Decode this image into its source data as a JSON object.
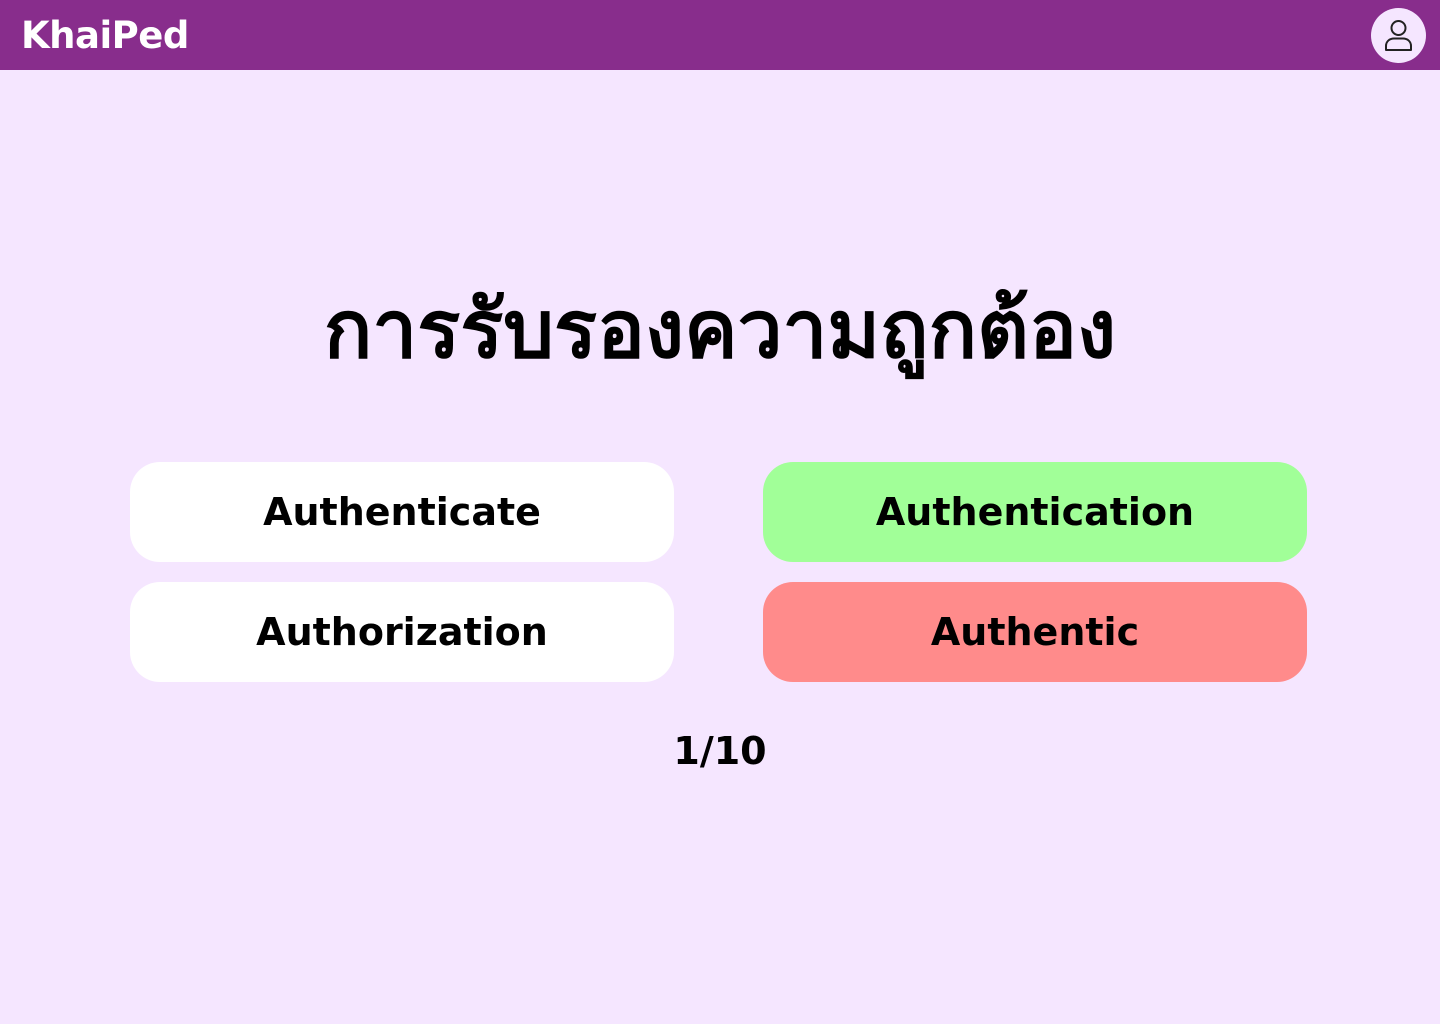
{
  "header": {
    "brand": "KhaiPed",
    "profile_icon": "user-icon",
    "background": "#882D8C"
  },
  "quiz": {
    "question": "การรับรองความถูกต้อง",
    "options": [
      {
        "label": "Authenticate",
        "state": "default",
        "color": "#FFFFFF"
      },
      {
        "label": "Authentication",
        "state": "correct",
        "color": "#A1FF98"
      },
      {
        "label": "Authorization",
        "state": "default",
        "color": "#FFFFFF"
      },
      {
        "label": "Authentic",
        "state": "incorrect",
        "color": "#FF8B8B"
      }
    ],
    "progress": "1/10"
  },
  "page": {
    "background": "#F5E6FF"
  }
}
